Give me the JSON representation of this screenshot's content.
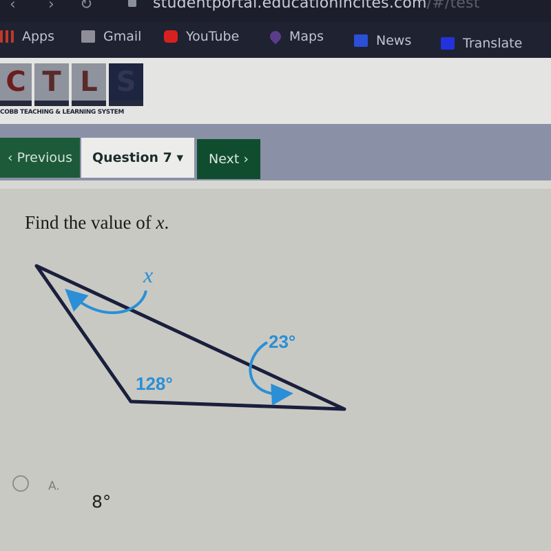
{
  "browser": {
    "url_main": "studentportal.educationincites.com",
    "url_path": "/#/test",
    "bookmarks": [
      {
        "label": "Apps",
        "icon": "apps-grid-icon",
        "color": "#c0392b"
      },
      {
        "label": "Gmail",
        "icon": "gmail-icon",
        "color": "#8e8e99"
      },
      {
        "label": "YouTube",
        "icon": "youtube-icon",
        "color": "#d92020"
      },
      {
        "label": "Maps",
        "icon": "maps-pin-icon",
        "color": "#5a3d8a"
      },
      {
        "label": "News",
        "icon": "news-icon",
        "color": "#2b4fd6"
      },
      {
        "label": "Translate",
        "icon": "translate-icon",
        "color": "#2233dd"
      }
    ]
  },
  "logo": {
    "letters": [
      "C",
      "T",
      "L",
      "S"
    ],
    "tagline": "COBB TEACHING & LEARNING SYSTEM"
  },
  "nav": {
    "previous_label": "‹ Previous",
    "question_label": "Question 7 ▾",
    "next_label": "Next ›"
  },
  "question": {
    "prompt_prefix": "Find the value of ",
    "prompt_var": "x",
    "prompt_suffix": ".",
    "figure": {
      "type": "triangle",
      "angle_labels": {
        "unknown": "x",
        "exterior": "23°",
        "obtuse": "128°"
      },
      "line_color": "#1a1f3d",
      "label_color": "#2a8fd6"
    }
  },
  "choices": [
    {
      "letter": "A.",
      "value": "8°",
      "selected": false
    }
  ]
}
